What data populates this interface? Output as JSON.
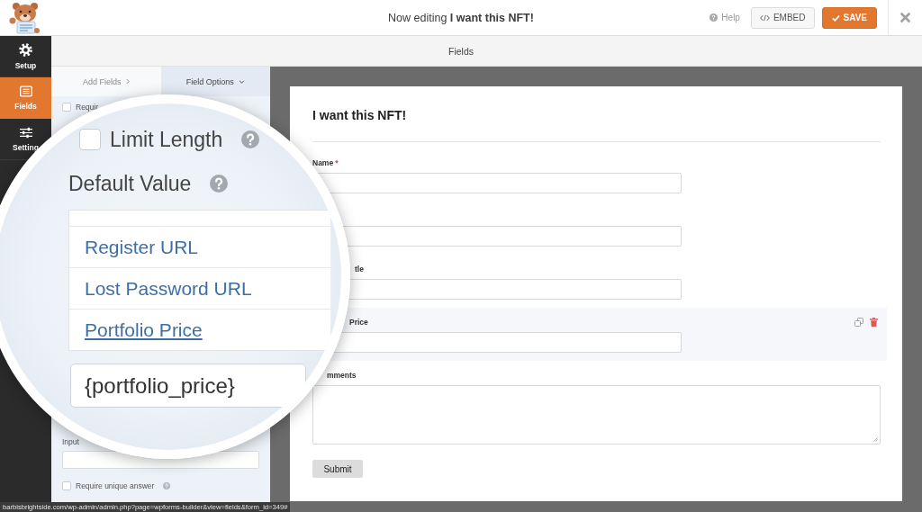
{
  "header": {
    "title": "Now editing **I want this NFT!**",
    "help": "Help",
    "buttons": [
      {
        "kind": "embed",
        "label": "EMBED"
      },
      {
        "kind": "save",
        "label": "SAVE"
      }
    ]
  },
  "sidebar": {
    "items": [
      {
        "kind": "gear",
        "label": "Setup",
        "selected": false
      },
      {
        "kind": "list",
        "label": "Fields",
        "selected": true
      },
      {
        "kind": "sliders",
        "label": "Setting",
        "selected": false
      }
    ]
  },
  "builder_bar": {
    "title": "Fields"
  },
  "panel": {
    "tabs": [
      {
        "kind": "forward",
        "label": "Add Fields",
        "selected": false
      },
      {
        "kind": "dropdown",
        "label": "Field Options",
        "selected": true
      }
    ],
    "top_options": [
      {
        "label": "Requir",
        "checked": false
      }
    ],
    "input_label": "Input",
    "bottom_options": [
      {
        "label": "Require unique answer",
        "checked": false,
        "help": true
      }
    ]
  },
  "magnifier": {
    "limit_length": {
      "label": "Limit Length",
      "checked": false,
      "help": true
    },
    "default_value": {
      "label": "Default Value",
      "help": true
    },
    "smart_tags": [
      {
        "label": "Register URL",
        "hovered": false
      },
      {
        "label": "Lost Password URL",
        "hovered": false
      },
      {
        "label": "Portfolio Price",
        "hovered": true
      }
    ],
    "value": "{portfolio_price}"
  },
  "form": {
    "title": "I want this NFT!",
    "fields": [
      {
        "kind": "text",
        "label": "Name",
        "required_mark": "*",
        "selected": false
      },
      {
        "kind": "text",
        "selected": false
      },
      {
        "kind": "text",
        "label": "tle",
        "selected": false
      },
      {
        "kind": "text",
        "label": "Price",
        "selected": true
      },
      {
        "kind": "textarea",
        "label": "mments",
        "selected": false
      }
    ],
    "submit": "Submit"
  },
  "status_bar": {
    "url": "barbisbrightside.com/wp-admin/admin.php?page=wpforms-builder&view=fields&form_id=349#"
  }
}
